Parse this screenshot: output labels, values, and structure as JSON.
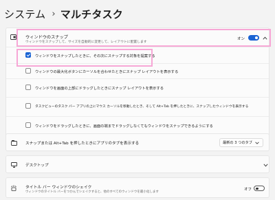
{
  "breadcrumb": {
    "parent": "システム",
    "separator": "›",
    "current": "マルチタスク"
  },
  "snap": {
    "title": "ウィンドウのスナップ",
    "subtitle": "ウィンドウをスナップして、サイズを自動的に変更して、レイアウトに配置します",
    "status": "オン",
    "toggle_on": true,
    "expanded": true,
    "options": [
      {
        "label": "ウィンドウをスナップしたときに、その次にスナップする対象を提案する",
        "checked": true
      },
      {
        "label": "ウィンドウの最大化ボタンにカーソルを合わせたときにスナップ レイアウトを表示する",
        "checked": false
      },
      {
        "label": "ウィンドウを画面の上部にドラッグしたときにスナップ レイアウトを表示する",
        "checked": false
      },
      {
        "label": "タスクビューのタスク バー アプリの上にマウス カーソルを移動したとき、そして Alt+Tab を押したときに、スナップしたウィンドウを表示する",
        "checked": false
      },
      {
        "label": "ウィンドウをドラッグしたときに、画面の端までドラッグしなくてもウィンドウをスナップできるようにする",
        "checked": false
      }
    ]
  },
  "alttab": {
    "title": "スナップまたは Alt+Tab を押したときにアプリのタブを表示する",
    "dropdown_value": "最新の 3 つのタブ",
    "dropdown_icon": "chevron-down-icon"
  },
  "desktop": {
    "title": "デスクトップ"
  },
  "shake": {
    "title": "タイトル バー ウィンドウのシェイク",
    "subtitle": "ウィンドウのタイトル バーをつかんでシェイクすると、他のすべてのウィンドウを最小化します",
    "status": "オフ",
    "toggle_on": false
  },
  "colors": {
    "accent": "#1a63d3",
    "highlight": "#f7a7d6"
  }
}
